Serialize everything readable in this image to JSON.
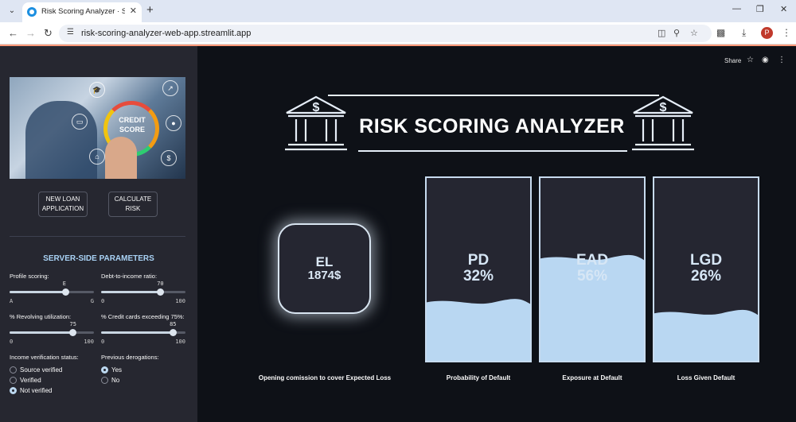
{
  "browser": {
    "tab_title": "Risk Scoring Analyzer · Streamlit",
    "url": "risk-scoring-analyzer-web-app.streamlit.app",
    "profile_initial": "P"
  },
  "sidebar": {
    "image_text": "CREDIT SCORE",
    "buttons": [
      {
        "line1": "NEW LOAN",
        "line2": "APPLICATION"
      },
      {
        "line1": "CALCULATE",
        "line2": "RISK"
      }
    ],
    "params_title": "SERVER-SIDE PARAMETERS",
    "sliders": [
      {
        "label": "Profile scoring:",
        "value": "E",
        "min": "A",
        "max": "G",
        "fraction": 0.667
      },
      {
        "label": "Debt-to-income ratio:",
        "value": "70",
        "min": "0",
        "max": "100",
        "fraction": 0.7
      },
      {
        "label": "% Revolving utilization:",
        "value": "75",
        "min": "0",
        "max": "100",
        "fraction": 0.75
      },
      {
        "label": "% Credit cards exceeding 75%:",
        "value": "85",
        "min": "0",
        "max": "100",
        "fraction": 0.85
      }
    ],
    "income_verification": {
      "title": "Income verification status:",
      "options": [
        "Source verified",
        "Verified",
        "Not verified"
      ],
      "selected": "Not verified"
    },
    "derogations": {
      "title": "Previous derogations:",
      "options": [
        "Yes",
        "No"
      ],
      "selected": "Yes"
    }
  },
  "main": {
    "share_label": "Share",
    "header_title": "RISK SCORING ANALYZER",
    "el_card": {
      "label": "EL",
      "value": "1874$"
    },
    "gauges": [
      {
        "label": "PD",
        "value": "32%",
        "fraction": 0.32,
        "caption": "Probability of Default"
      },
      {
        "label": "EAD",
        "value": "56%",
        "fraction": 0.56,
        "caption": "Exposure at Default"
      },
      {
        "label": "LGD",
        "value": "26%",
        "fraction": 0.26,
        "caption": "Loss Given Default"
      }
    ],
    "el_caption": "Opening comission to cover Expected Loss"
  },
  "colors": {
    "accent": "#a9d2f5",
    "liquid": "#b9d7f2",
    "sidebar_bg": "#262730",
    "main_bg": "#0e1117"
  }
}
